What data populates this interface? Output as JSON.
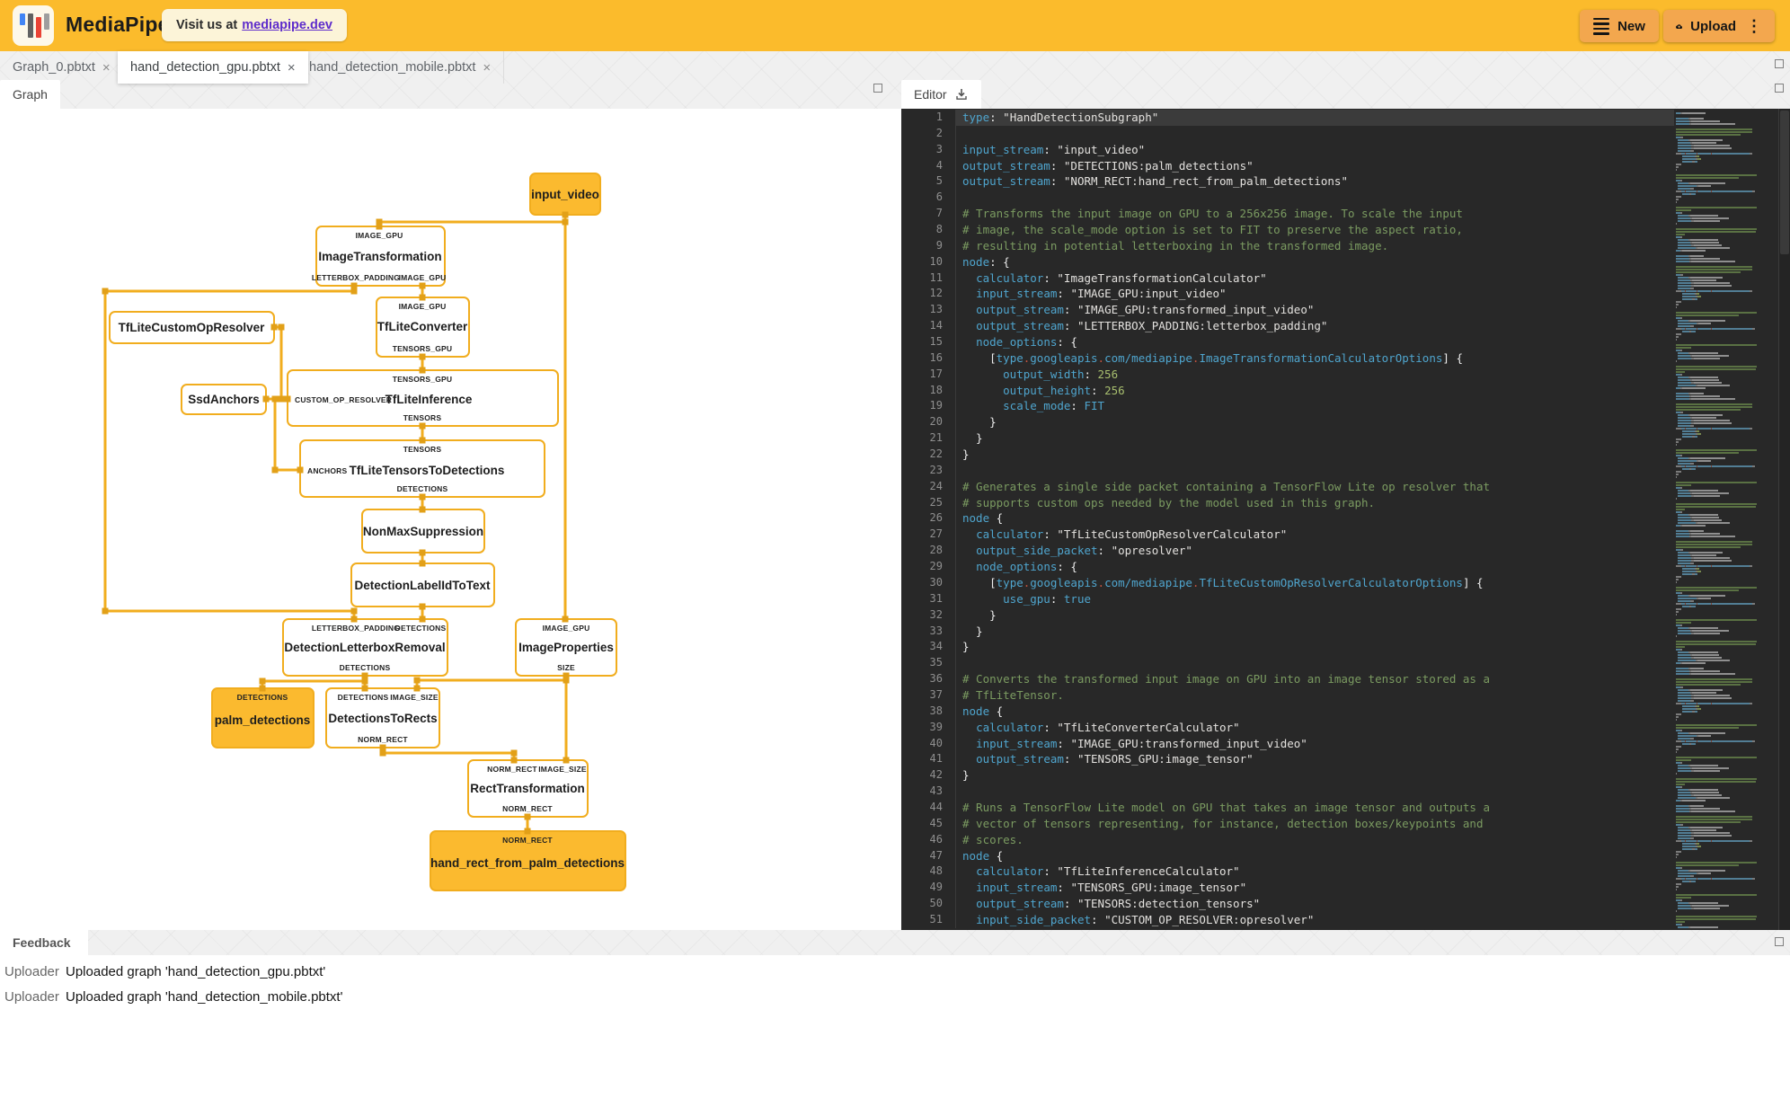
{
  "header": {
    "brand": "MediaPipe",
    "visit_prefix": "Visit us at",
    "visit_link": "mediapipe.dev",
    "new_label": "New",
    "upload_label": "Upload"
  },
  "ui": {
    "close_glyph": "×",
    "kebab_glyph": "⋮"
  },
  "file_tabs": [
    {
      "label": "Graph_0.pbtxt"
    },
    {
      "label": "hand_detection_gpu.pbtxt"
    },
    {
      "label": "hand_detection_mobile.pbtxt"
    }
  ],
  "panel_tabs": {
    "graph": "Graph",
    "editor": "Editor",
    "feedback": "Feedback"
  },
  "graph": {
    "nodes": [
      {
        "label": "input_video",
        "top": [],
        "bottom": [],
        "left": []
      },
      {
        "label": "ImageTransformation",
        "top": [
          "IMAGE_GPU"
        ],
        "bottom": [
          "LETTERBOX_PADDING",
          "IMAGE_GPU"
        ],
        "left": []
      },
      {
        "label": "TfLiteConverter",
        "top": [
          "IMAGE_GPU"
        ],
        "bottom": [
          "TENSORS_GPU"
        ],
        "left": []
      },
      {
        "label": "TfLiteCustomOpResolver",
        "top": [],
        "bottom": [],
        "left": []
      },
      {
        "label": "SsdAnchors",
        "top": [],
        "bottom": [],
        "left": []
      },
      {
        "label": "TfLiteInference",
        "top": [
          "TENSORS_GPU"
        ],
        "bottom": [
          "TENSORS"
        ],
        "left": [
          "CUSTOM_OP_RESOLVER"
        ]
      },
      {
        "label": "TfLiteTensorsToDetections",
        "top": [
          "TENSORS"
        ],
        "bottom": [
          "DETECTIONS"
        ],
        "left": [
          "ANCHORS"
        ]
      },
      {
        "label": "NonMaxSuppression",
        "top": [],
        "bottom": [],
        "left": []
      },
      {
        "label": "DetectionLabelIdToText",
        "top": [],
        "bottom": [],
        "left": []
      },
      {
        "label": "DetectionLetterboxRemoval",
        "top": [
          "LETTERBOX_PADDING",
          "DETECTIONS"
        ],
        "bottom": [
          "DETECTIONS"
        ],
        "left": []
      },
      {
        "label": "ImageProperties",
        "top": [
          "IMAGE_GPU"
        ],
        "bottom": [
          "SIZE"
        ],
        "left": []
      },
      {
        "label": "palm_detections",
        "top": [
          "DETECTIONS"
        ],
        "bottom": [],
        "left": []
      },
      {
        "label": "DetectionsToRects",
        "top": [
          "DETECTIONS",
          "IMAGE_SIZE"
        ],
        "bottom": [
          "NORM_RECT"
        ],
        "left": []
      },
      {
        "label": "RectTransformation",
        "top": [
          "NORM_RECT",
          "IMAGE_SIZE"
        ],
        "bottom": [
          "NORM_RECT"
        ],
        "left": []
      },
      {
        "label": "hand_rect_from_palm_detections",
        "top": [
          "NORM_RECT"
        ],
        "bottom": [],
        "left": []
      }
    ]
  },
  "editor": {
    "active_line": 1,
    "lines": [
      {
        "n": 1,
        "s": [
          [
            "k",
            "type"
          ],
          [
            "p",
            ": "
          ],
          [
            "str",
            "\"HandDetectionSubgraph\""
          ]
        ]
      },
      {
        "n": 2,
        "s": []
      },
      {
        "n": 3,
        "s": [
          [
            "k",
            "input_stream"
          ],
          [
            "p",
            ": "
          ],
          [
            "str",
            "\"input_video\""
          ]
        ]
      },
      {
        "n": 4,
        "s": [
          [
            "k",
            "output_stream"
          ],
          [
            "p",
            ": "
          ],
          [
            "str",
            "\"DETECTIONS:palm_detections\""
          ]
        ]
      },
      {
        "n": 5,
        "s": [
          [
            "k",
            "output_stream"
          ],
          [
            "p",
            ": "
          ],
          [
            "str",
            "\"NORM_RECT:hand_rect_from_palm_detections\""
          ]
        ]
      },
      {
        "n": 6,
        "s": []
      },
      {
        "n": 7,
        "s": [
          [
            "c",
            "# Transforms the input image on GPU to a 256x256 image. To scale the input"
          ]
        ]
      },
      {
        "n": 8,
        "s": [
          [
            "c",
            "# image, the scale_mode option is set to FIT to preserve the aspect ratio,"
          ]
        ]
      },
      {
        "n": 9,
        "s": [
          [
            "c",
            "# resulting in potential letterboxing in the transformed image."
          ]
        ]
      },
      {
        "n": 10,
        "s": [
          [
            "k",
            "node"
          ],
          [
            "p",
            ": {"
          ]
        ]
      },
      {
        "n": 11,
        "s": [
          [
            "p",
            "  "
          ],
          [
            "k",
            "calculator"
          ],
          [
            "p",
            ": "
          ],
          [
            "str",
            "\"ImageTransformationCalculator\""
          ]
        ]
      },
      {
        "n": 12,
        "s": [
          [
            "p",
            "  "
          ],
          [
            "k",
            "input_stream"
          ],
          [
            "p",
            ": "
          ],
          [
            "str",
            "\"IMAGE_GPU:input_video\""
          ]
        ]
      },
      {
        "n": 13,
        "s": [
          [
            "p",
            "  "
          ],
          [
            "k",
            "output_stream"
          ],
          [
            "p",
            ": "
          ],
          [
            "str",
            "\"IMAGE_GPU:transformed_input_video\""
          ]
        ]
      },
      {
        "n": 14,
        "s": [
          [
            "p",
            "  "
          ],
          [
            "k",
            "output_stream"
          ],
          [
            "p",
            ": "
          ],
          [
            "str",
            "\"LETTERBOX_PADDING:letterbox_padding\""
          ]
        ]
      },
      {
        "n": 15,
        "s": [
          [
            "p",
            "  "
          ],
          [
            "k",
            "node_options"
          ],
          [
            "p",
            ": {"
          ]
        ]
      },
      {
        "n": 16,
        "s": [
          [
            "p",
            "    ["
          ],
          [
            "k",
            "type"
          ],
          [
            "dot",
            "."
          ],
          [
            "k",
            "googleapis"
          ],
          [
            "dot",
            "."
          ],
          [
            "k",
            "com/mediapipe"
          ],
          [
            "dot",
            "."
          ],
          [
            "k",
            "ImageTransformationCalculatorOptions"
          ],
          [
            "p",
            "] {"
          ]
        ]
      },
      {
        "n": 17,
        "s": [
          [
            "p",
            "      "
          ],
          [
            "k",
            "output_width"
          ],
          [
            "p",
            ": "
          ],
          [
            "num",
            "256"
          ]
        ]
      },
      {
        "n": 18,
        "s": [
          [
            "p",
            "      "
          ],
          [
            "k",
            "output_height"
          ],
          [
            "p",
            ": "
          ],
          [
            "num",
            "256"
          ]
        ]
      },
      {
        "n": 19,
        "s": [
          [
            "p",
            "      "
          ],
          [
            "k",
            "scale_mode"
          ],
          [
            "p",
            ": "
          ],
          [
            "lit",
            "FIT"
          ]
        ]
      },
      {
        "n": 20,
        "s": [
          [
            "p",
            "    }"
          ]
        ]
      },
      {
        "n": 21,
        "s": [
          [
            "p",
            "  }"
          ]
        ]
      },
      {
        "n": 22,
        "s": [
          [
            "p",
            "}"
          ]
        ]
      },
      {
        "n": 23,
        "s": []
      },
      {
        "n": 24,
        "s": [
          [
            "c",
            "# Generates a single side packet containing a TensorFlow Lite op resolver that"
          ]
        ]
      },
      {
        "n": 25,
        "s": [
          [
            "c",
            "# supports custom ops needed by the model used in this graph."
          ]
        ]
      },
      {
        "n": 26,
        "s": [
          [
            "k",
            "node"
          ],
          [
            "p",
            " {"
          ]
        ]
      },
      {
        "n": 27,
        "s": [
          [
            "p",
            "  "
          ],
          [
            "k",
            "calculator"
          ],
          [
            "p",
            ": "
          ],
          [
            "str",
            "\"TfLiteCustomOpResolverCalculator\""
          ]
        ]
      },
      {
        "n": 28,
        "s": [
          [
            "p",
            "  "
          ],
          [
            "k",
            "output_side_packet"
          ],
          [
            "p",
            ": "
          ],
          [
            "str",
            "\"opresolver\""
          ]
        ]
      },
      {
        "n": 29,
        "s": [
          [
            "p",
            "  "
          ],
          [
            "k",
            "node_options"
          ],
          [
            "p",
            ": {"
          ]
        ]
      },
      {
        "n": 30,
        "s": [
          [
            "p",
            "    ["
          ],
          [
            "k",
            "type"
          ],
          [
            "dot",
            "."
          ],
          [
            "k",
            "googleapis"
          ],
          [
            "dot",
            "."
          ],
          [
            "k",
            "com/mediapipe"
          ],
          [
            "dot",
            "."
          ],
          [
            "k",
            "TfLiteCustomOpResolverCalculatorOptions"
          ],
          [
            "p",
            "] {"
          ]
        ]
      },
      {
        "n": 31,
        "s": [
          [
            "p",
            "      "
          ],
          [
            "k",
            "use_gpu"
          ],
          [
            "p",
            ": "
          ],
          [
            "lit",
            "true"
          ]
        ]
      },
      {
        "n": 32,
        "s": [
          [
            "p",
            "    }"
          ]
        ]
      },
      {
        "n": 33,
        "s": [
          [
            "p",
            "  }"
          ]
        ]
      },
      {
        "n": 34,
        "s": [
          [
            "p",
            "}"
          ]
        ]
      },
      {
        "n": 35,
        "s": []
      },
      {
        "n": 36,
        "s": [
          [
            "c",
            "# Converts the transformed input image on GPU into an image tensor stored as a"
          ]
        ]
      },
      {
        "n": 37,
        "s": [
          [
            "c",
            "# TfLiteTensor."
          ]
        ]
      },
      {
        "n": 38,
        "s": [
          [
            "k",
            "node"
          ],
          [
            "p",
            " {"
          ]
        ]
      },
      {
        "n": 39,
        "s": [
          [
            "p",
            "  "
          ],
          [
            "k",
            "calculator"
          ],
          [
            "p",
            ": "
          ],
          [
            "str",
            "\"TfLiteConverterCalculator\""
          ]
        ]
      },
      {
        "n": 40,
        "s": [
          [
            "p",
            "  "
          ],
          [
            "k",
            "input_stream"
          ],
          [
            "p",
            ": "
          ],
          [
            "str",
            "\"IMAGE_GPU:transformed_input_video\""
          ]
        ]
      },
      {
        "n": 41,
        "s": [
          [
            "p",
            "  "
          ],
          [
            "k",
            "output_stream"
          ],
          [
            "p",
            ": "
          ],
          [
            "str",
            "\"TENSORS_GPU:image_tensor\""
          ]
        ]
      },
      {
        "n": 42,
        "s": [
          [
            "p",
            "}"
          ]
        ]
      },
      {
        "n": 43,
        "s": []
      },
      {
        "n": 44,
        "s": [
          [
            "c",
            "# Runs a TensorFlow Lite model on GPU that takes an image tensor and outputs a"
          ]
        ]
      },
      {
        "n": 45,
        "s": [
          [
            "c",
            "# vector of tensors representing, for instance, detection boxes/keypoints and"
          ]
        ]
      },
      {
        "n": 46,
        "s": [
          [
            "c",
            "# scores."
          ]
        ]
      },
      {
        "n": 47,
        "s": [
          [
            "k",
            "node"
          ],
          [
            "p",
            " {"
          ]
        ]
      },
      {
        "n": 48,
        "s": [
          [
            "p",
            "  "
          ],
          [
            "k",
            "calculator"
          ],
          [
            "p",
            ": "
          ],
          [
            "str",
            "\"TfLiteInferenceCalculator\""
          ]
        ]
      },
      {
        "n": 49,
        "s": [
          [
            "p",
            "  "
          ],
          [
            "k",
            "input_stream"
          ],
          [
            "p",
            ": "
          ],
          [
            "str",
            "\"TENSORS_GPU:image_tensor\""
          ]
        ]
      },
      {
        "n": 50,
        "s": [
          [
            "p",
            "  "
          ],
          [
            "k",
            "output_stream"
          ],
          [
            "p",
            ": "
          ],
          [
            "str",
            "\"TENSORS:detection_tensors\""
          ]
        ]
      },
      {
        "n": 51,
        "s": [
          [
            "p",
            "  "
          ],
          [
            "k",
            "input_side_packet"
          ],
          [
            "p",
            ": "
          ],
          [
            "str",
            "\"CUSTOM_OP_RESOLVER:opresolver\""
          ]
        ]
      }
    ]
  },
  "feedback": {
    "rows": [
      {
        "source": "Uploader",
        "message": "Uploaded graph 'hand_detection_gpu.pbtxt'"
      },
      {
        "source": "Uploader",
        "message": "Uploaded graph 'hand_detection_mobile.pbtxt'"
      }
    ]
  }
}
